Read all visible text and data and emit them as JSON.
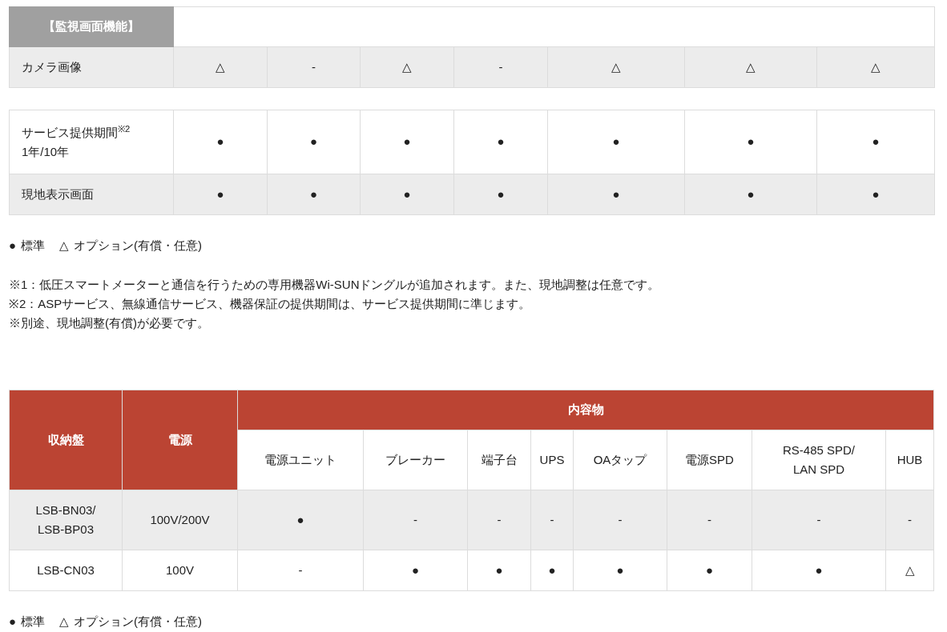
{
  "monitor_table": {
    "header": "【監視画面機能】",
    "rows": [
      {
        "label_lines": [
          "カメラ画像"
        ],
        "shaded": true,
        "cells": [
          "△",
          "-",
          "△",
          "-",
          "△",
          "△",
          "△"
        ]
      }
    ]
  },
  "service_table": {
    "rows": [
      {
        "label_lines": [
          "サービス提供期間$^{※2}$",
          "1年/10年"
        ],
        "shaded": false,
        "cells": [
          "●",
          "●",
          "●",
          "●",
          "●",
          "●",
          "●"
        ]
      },
      {
        "label_lines": [
          "現地表示画面"
        ],
        "shaded": true,
        "cells": [
          "●",
          "●",
          "●",
          "●",
          "●",
          "●",
          "●"
        ]
      }
    ]
  },
  "legend_1": {
    "standard_mark": "●",
    "standard": "標準",
    "option_mark": "△",
    "option": "オプション(有償・任意)"
  },
  "notes": [
    "※1：低圧スマートメーターと通信を行うための専用機器Wi-SUNドングルが追加されます。また、現地調整は任意です。",
    "※2：ASPサービス、無線通信サービス、機器保証の提供期間は、サービス提供期間に準じます。",
    "※別途、現地調整(有償)が必要です。"
  ],
  "cabinet_table": {
    "columns": [
      "収納盤",
      "電源"
    ],
    "group_header": "内容物",
    "sub_columns": [
      [
        "電源ユニット"
      ],
      [
        "ブレーカー"
      ],
      [
        "端子台"
      ],
      [
        "UPS"
      ],
      [
        "OAタップ"
      ],
      [
        "電源SPD"
      ],
      [
        "RS-485 SPD/",
        "LAN SPD"
      ],
      [
        "HUB"
      ]
    ],
    "rows": [
      {
        "model_lines": [
          "LSB-BN03/",
          "LSB-BP03"
        ],
        "power": "100V/200V",
        "shaded": true,
        "cells": [
          "●",
          "-",
          "-",
          "-",
          "-",
          "-",
          "-",
          "-"
        ]
      },
      {
        "model_lines": [
          "LSB-CN03"
        ],
        "power": "100V",
        "shaded": false,
        "cells": [
          "-",
          "●",
          "●",
          "●",
          "●",
          "●",
          "●",
          "△"
        ]
      }
    ]
  },
  "legend_2": {
    "standard_mark": "●",
    "standard": "標準",
    "option_mark": "△",
    "option": "オプション(有償・任意)"
  }
}
